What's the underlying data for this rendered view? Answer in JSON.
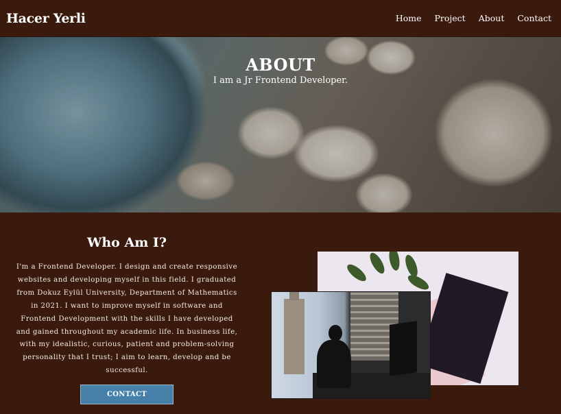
{
  "navbar": {
    "brand": "Hacer Yerli",
    "links": [
      "Home",
      "Project",
      "About",
      "Contact"
    ]
  },
  "hero": {
    "title": "ABOUT",
    "subtitle": "I am a Jr Frontend Developer."
  },
  "about": {
    "heading": "Who Am I?",
    "bio": "I'm a Frontend Developer. I design and create responsive websites and developing myself in this field. I graduated from Dokuz Eylül University, Department of Mathematics in 2021. I want to improve myself in software and Frontend Development with the skills I have developed and gained throughout my academic life. In business life, with my idealistic, curious, patient and problem-solving personality that I trust; I aim to learn, develop and be successful.",
    "button_label": "CONTACT"
  },
  "colors": {
    "background": "#3a1a0c",
    "button": "#4680a8"
  },
  "icons": {
    "hero_image": "rocky-shore-photo",
    "photo_back": "notebook-leaves-photo",
    "photo_front": "office-desk-photo"
  }
}
